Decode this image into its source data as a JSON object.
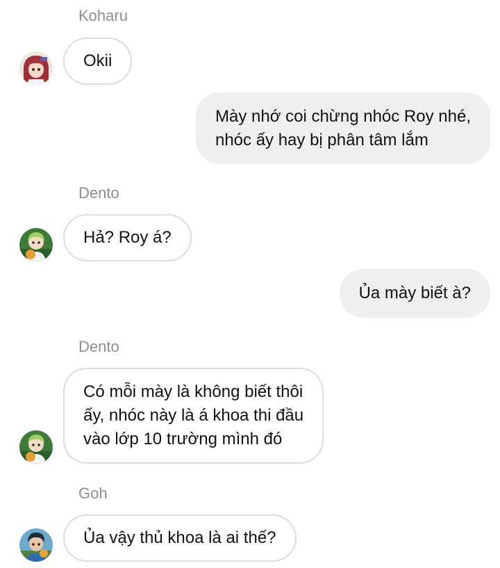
{
  "messages": [
    {
      "sender": "Koharu",
      "text": "Okii"
    },
    {
      "sender": "me",
      "text": "Mày nhớ coi chừng nhóc Roy nhé,\nnhóc ấy hay bị phân tâm lắm"
    },
    {
      "sender": "Dento",
      "text": "Hả? Roy á?"
    },
    {
      "sender": "me",
      "text": "Ủa mày biết à?"
    },
    {
      "sender": "Dento",
      "text": "Có mỗi mày là không biết thôi\nấy, nhóc này là á khoa thi đầu\nvào lớp 10 trường mình đó"
    },
    {
      "sender": "Goh",
      "text": "Ủa vậy thủ khoa là ai thế?"
    }
  ],
  "colors": {
    "incoming_border": "#dcdcdc",
    "outgoing_bg": "#efefef",
    "sender_name": "#8e8e8e"
  },
  "avatars": {
    "koharu": "koharu-avatar",
    "dento": "dento-avatar",
    "goh": "goh-avatar"
  }
}
